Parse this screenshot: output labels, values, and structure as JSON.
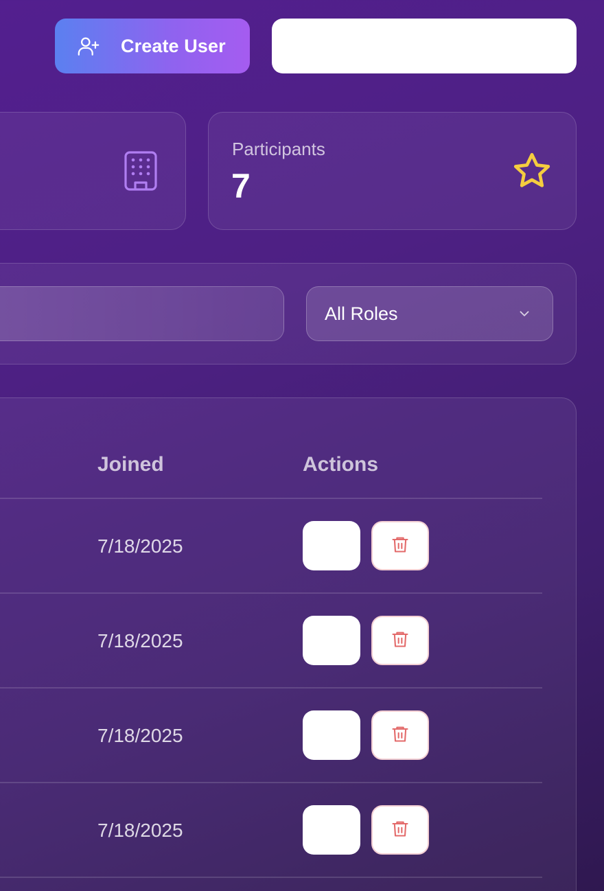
{
  "header": {
    "create_button": {
      "label": "Create User",
      "icon": "user-plus-icon"
    }
  },
  "stats": {
    "left_card": {
      "icon": "building-icon"
    },
    "participants": {
      "label": "Participants",
      "value": "7",
      "icon": "star-icon"
    }
  },
  "filters": {
    "role": {
      "selected": "All Roles",
      "icon": "chevron-down-icon"
    }
  },
  "table": {
    "columns": [
      "Joined",
      "Actions"
    ],
    "rows": [
      {
        "joined": "7/18/2025"
      },
      {
        "joined": "7/18/2025"
      },
      {
        "joined": "7/18/2025"
      },
      {
        "joined": "7/18/2025"
      }
    ]
  },
  "colors": {
    "accent_gradient_start": "#5b80f0",
    "accent_gradient_end": "#a55cf0",
    "building_icon": "#b07ef2",
    "star_icon": "#f5cd3f",
    "delete_icon": "#e36a6a"
  }
}
